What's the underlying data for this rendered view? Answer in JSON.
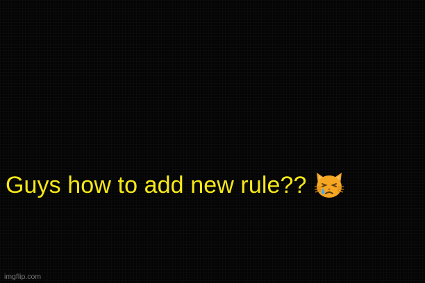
{
  "meme": {
    "caption": "Guys how to add new rule??",
    "emoji_icon": "crying-cat-face-icon",
    "text_color": "#f7e81a",
    "background_color": "#000000"
  },
  "watermark": {
    "text": "imgflip.com"
  }
}
